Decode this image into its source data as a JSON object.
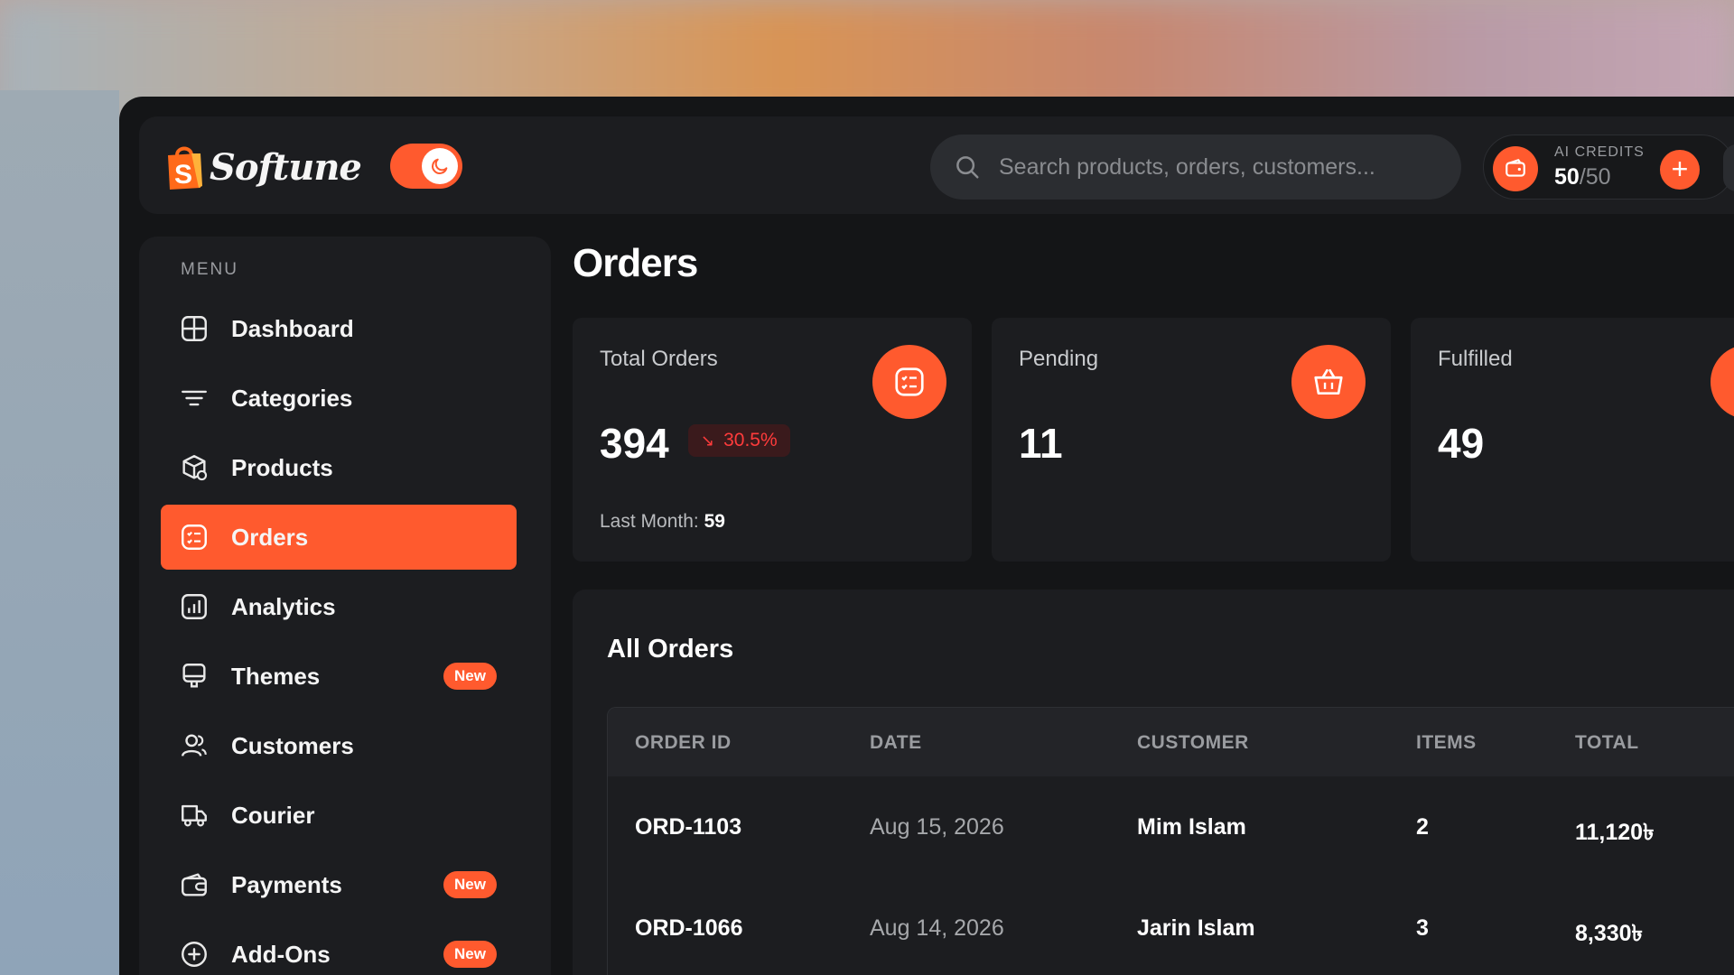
{
  "app": {
    "brand": "Softune"
  },
  "search": {
    "placeholder": "Search products, orders, customers..."
  },
  "credits": {
    "label": "AI CREDITS",
    "used": "50",
    "max": "/50"
  },
  "sidebar": {
    "menu_label": "MENU",
    "items": [
      {
        "label": "Dashboard",
        "icon": "dashboard-icon"
      },
      {
        "label": "Categories",
        "icon": "filter-icon"
      },
      {
        "label": "Products",
        "icon": "box-icon"
      },
      {
        "label": "Orders",
        "icon": "orders-icon",
        "active": true
      },
      {
        "label": "Analytics",
        "icon": "analytics-icon"
      },
      {
        "label": "Themes",
        "icon": "themes-icon",
        "badge": "New"
      },
      {
        "label": "Customers",
        "icon": "users-icon"
      },
      {
        "label": "Courier",
        "icon": "truck-icon"
      },
      {
        "label": "Payments",
        "icon": "wallet-icon",
        "badge": "New"
      },
      {
        "label": "Add-Ons",
        "icon": "plus-circle-icon",
        "badge": "New"
      }
    ]
  },
  "page": {
    "title": "Orders"
  },
  "stats": [
    {
      "label": "Total Orders",
      "value": "394",
      "delta": "30.5%",
      "last_label": "Last Month: ",
      "last_value": "59",
      "icon": "orders-icon"
    },
    {
      "label": "Pending",
      "value": "11",
      "icon": "basket-icon"
    },
    {
      "label": "Fulfilled",
      "value": "49",
      "icon": "check-icon"
    }
  ],
  "orders": {
    "title": "All Orders",
    "columns": [
      "ORDER ID",
      "DATE",
      "CUSTOMER",
      "ITEMS",
      "TOTAL"
    ],
    "rows": [
      {
        "id": "ORD-1103",
        "date": "Aug 15, 2026",
        "customer": "Mim Islam",
        "items": "2",
        "total": "11,120৳"
      },
      {
        "id": "ORD-1066",
        "date": "Aug 14, 2026",
        "customer": "Jarin Islam",
        "items": "3",
        "total": "8,330৳"
      }
    ]
  },
  "colors": {
    "accent": "#ff5a2e",
    "panel": "#1c1d20",
    "background": "#141517",
    "negative": "#ff3b3b"
  }
}
